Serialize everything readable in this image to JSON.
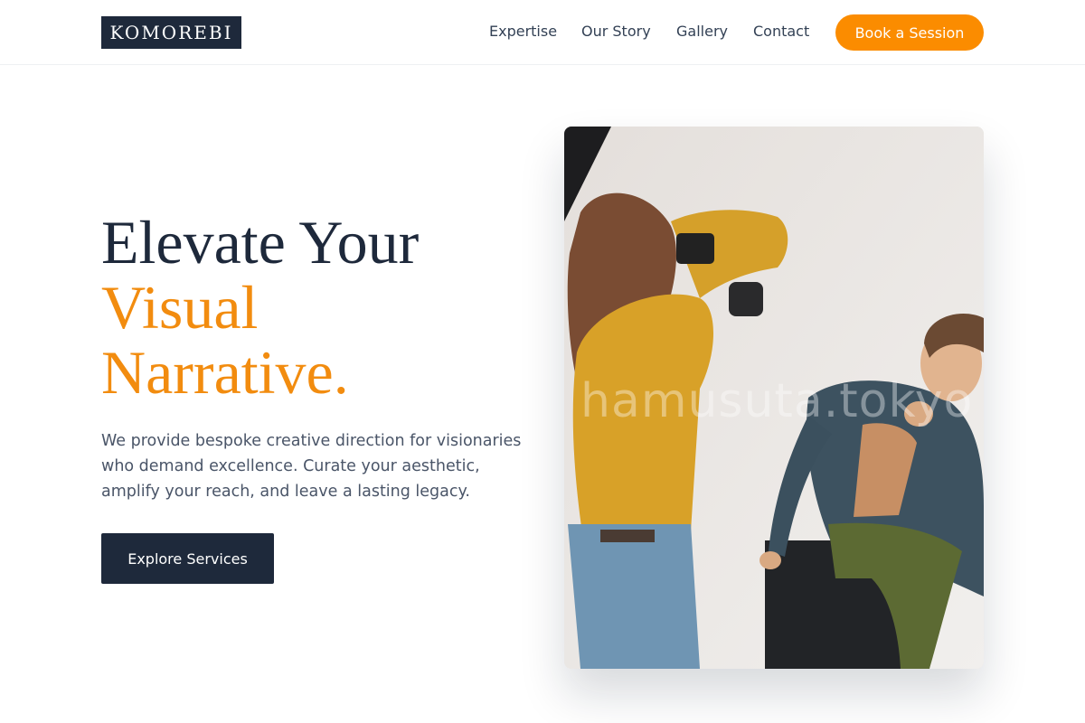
{
  "header": {
    "logo": "KOMOREBI",
    "nav": [
      "Expertise",
      "Our Story",
      "Gallery",
      "Contact"
    ],
    "cta_label": "Book a Session"
  },
  "hero": {
    "headline_line1": "Elevate Your",
    "headline_line2": "Visual",
    "headline_line3": "Narrative.",
    "lead": "We provide bespoke creative direction for visionaries who demand excellence. Curate your aesthetic, amplify your reach, and leave a lasting legacy.",
    "button_label": "Explore Services",
    "image_watermark": "hamusuta.tokyo"
  },
  "colors": {
    "brand_navy": "#1e293b",
    "accent_orange": "#fb8c00",
    "body_text": "#4a5568"
  }
}
